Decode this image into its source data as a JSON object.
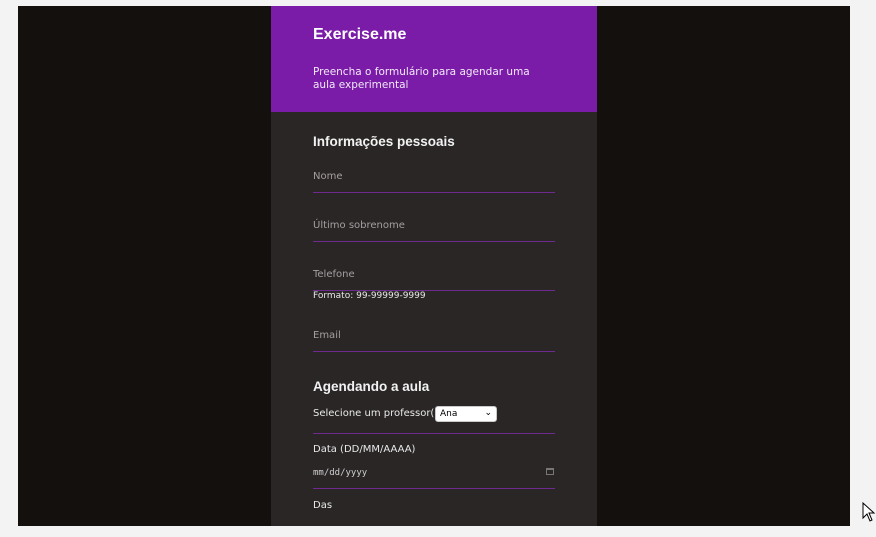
{
  "header": {
    "title": "Exercise.me",
    "subtitle": "Preencha o formulário para agendar uma aula experimental"
  },
  "personal": {
    "section_title": "Informações pessoais",
    "name_placeholder": "Nome",
    "last_name_placeholder": "Último sobrenome",
    "phone_placeholder": "Telefone",
    "phone_helper": "Formato: 99-99999-9999",
    "email_placeholder": "Email"
  },
  "schedule": {
    "section_title": "Agendando a aula",
    "teacher_label": "Selecione um professor(a)",
    "teacher_selected": "Ana",
    "date_label": "Data (DD/MM/AAAA)",
    "date_value": "mm/dd/yyyy",
    "from_label": "Das"
  },
  "icons": {
    "select": "chevron-down-icon",
    "date": "calendar-icon",
    "cursor": "mouse-cursor-icon"
  },
  "colors": {
    "header_bg": "#7a1ca8",
    "card_bg": "#2a2626",
    "page_bg": "#13100d",
    "field_line": "#6f2a8f"
  }
}
